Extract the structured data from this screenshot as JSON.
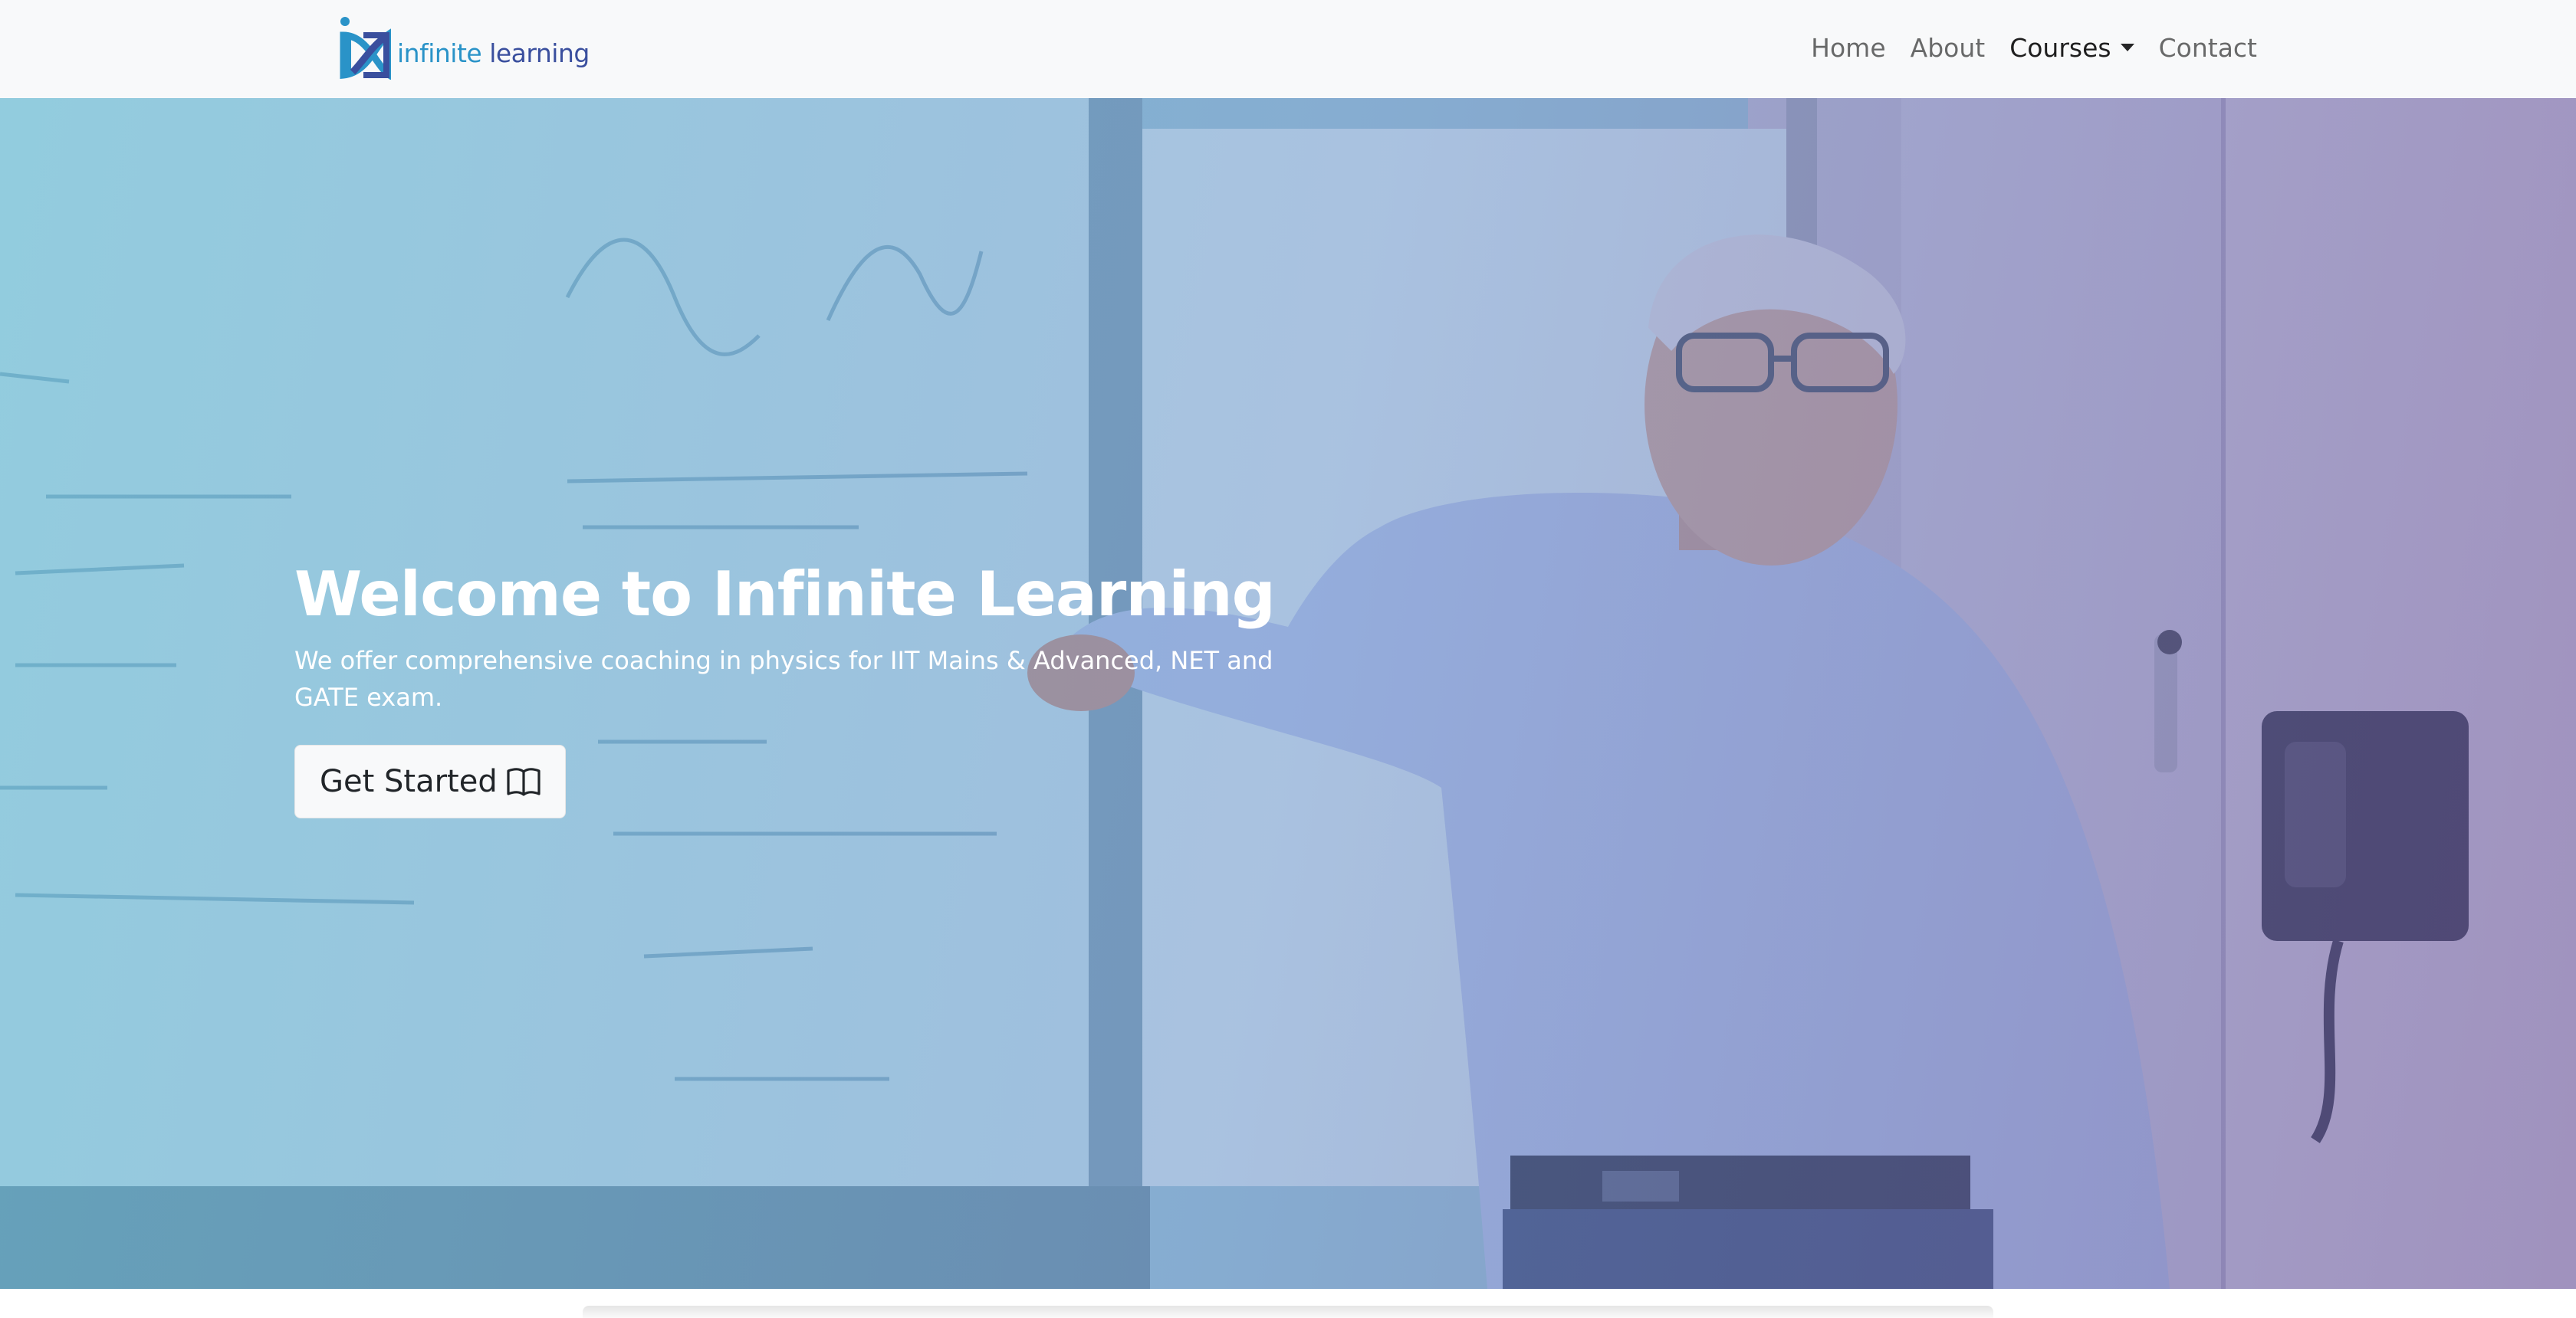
{
  "brand": {
    "name_part1": "infinite",
    "name_part2": "learning",
    "logo_icon": "infinity-i-logo"
  },
  "nav": {
    "items": [
      {
        "label": "Home"
      },
      {
        "label": "About"
      },
      {
        "label": "Courses",
        "has_dropdown": true,
        "active": true
      },
      {
        "label": "Contact"
      }
    ]
  },
  "hero": {
    "title": "Welcome to Infinite Learning",
    "subtitle": "We offer comprehensive coaching in physics for IIT Mains & Advanced, NET and GATE exam.",
    "cta_label": "Get Started",
    "cta_icon": "book-icon",
    "image": "teacher pointing at whiteboard with physics equations"
  },
  "colors": {
    "navbar_bg": "#f8f9fa",
    "brand_blue_light": "#2a93c8",
    "brand_blue_dark": "#3a4f9e",
    "overlay_left": "#60b5d1",
    "overlay_right": "#6e5ca0",
    "button_bg": "#f8f9fa"
  }
}
